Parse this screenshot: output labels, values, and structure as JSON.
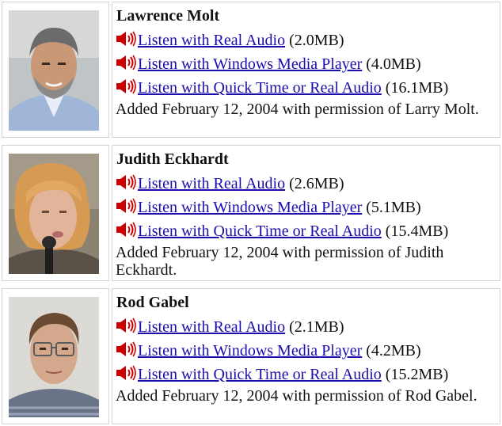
{
  "entries": [
    {
      "name": "Lawrence Molt",
      "links": [
        {
          "label": "Listen with Real Audio",
          "size": "(2.0MB)"
        },
        {
          "label": "Listen with Windows Media Player",
          "size": "(4.0MB)"
        },
        {
          "label": "Listen with Quick Time or Real Audio",
          "size": "(16.1MB)"
        }
      ],
      "note": "Added February 12, 2004 with permission of Larry Molt."
    },
    {
      "name": "Judith Eckhardt",
      "links": [
        {
          "label": "Listen with Real Audio",
          "size": "(2.6MB)"
        },
        {
          "label": "Listen with Windows Media Player",
          "size": "(5.1MB)"
        },
        {
          "label": "Listen with Quick Time or Real Audio",
          "size": "(15.4MB)"
        }
      ],
      "note": "Added February 12, 2004 with permission of Judith Eckhardt."
    },
    {
      "name": "Rod Gabel",
      "links": [
        {
          "label": "Listen with Real Audio",
          "size": "(2.1MB)"
        },
        {
          "label": "Listen with Windows Media Player",
          "size": "(4.2MB)"
        },
        {
          "label": "Listen with Quick Time or Real Audio",
          "size": "(15.2MB)"
        }
      ],
      "note": "Added February 12, 2004 with permission of Rod Gabel."
    }
  ],
  "icons": {
    "audio": "speaker-icon"
  },
  "colors": {
    "link": "#1a0dab",
    "speaker": "#cc0000",
    "border": "#d4d4d4"
  }
}
